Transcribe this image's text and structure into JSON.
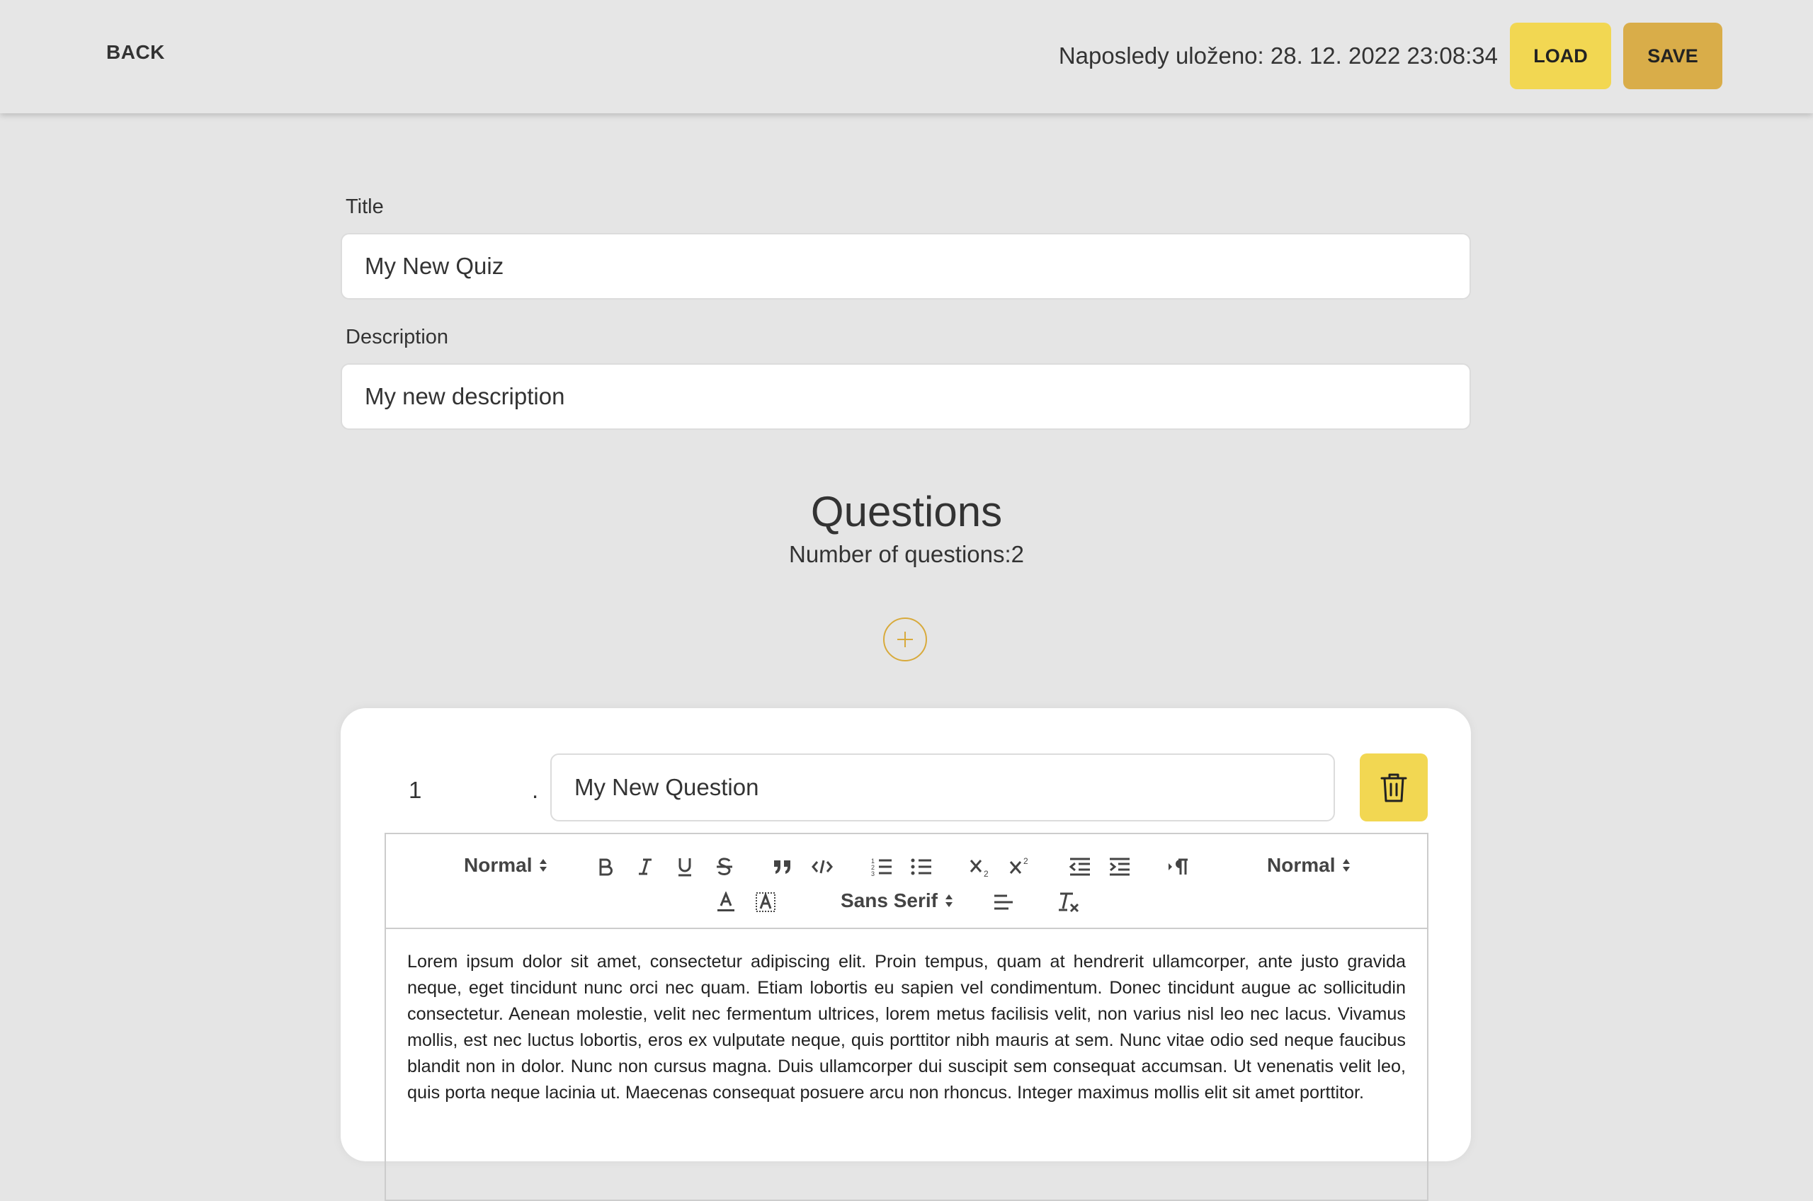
{
  "header": {
    "back_label": "BACK",
    "last_saved": "Naposledy uloženo: 28. 12. 2022 23:08:34",
    "load_label": "LOAD",
    "save_label": "SAVE"
  },
  "form": {
    "title_label": "Title",
    "title_value": "My New Quiz",
    "description_label": "Description",
    "description_value": "My new description"
  },
  "questions": {
    "heading": "Questions",
    "count_text": "Number of questions:2",
    "add_icon": "plus-circle-icon"
  },
  "question_items": [
    {
      "number": "1",
      "separator": ".",
      "text": "My New Question",
      "delete_icon": "trash-icon",
      "editor": {
        "toolbar": {
          "header_select": "Normal",
          "size_select": "Normal",
          "font_select": "Sans Serif",
          "buttons": [
            "bold",
            "italic",
            "underline",
            "strike",
            "blockquote",
            "code-block",
            "ordered-list",
            "bullet-list",
            "subscript",
            "superscript",
            "outdent",
            "indent",
            "direction",
            "color",
            "background",
            "align",
            "clean"
          ]
        },
        "content": "Lorem ipsum dolor sit amet, consectetur adipiscing elit. Proin tempus, quam at hendrerit ullamcorper, ante justo gravida neque, eget tincidunt nunc orci nec quam. Etiam lobortis eu sapien vel condimentum. Donec tincidunt augue ac sollicitudin consectetur. Aenean molestie, velit nec fermentum ultrices, lorem metus facilisis velit, non varius nisl leo nec lacus. Vivamus mollis, est nec luctus lobortis, eros ex vulputate neque, quis porttitor nibh mauris at sem. Nunc vitae odio sed neque faucibus blandit non in dolor. Nunc non cursus magna. Duis ullamcorper dui suscipit sem consequat accumsan. Ut venenatis velit leo, quis porta neque lacinia ut. Maecenas consequat posuere arcu non rhoncus. Integer maximus mollis elit sit amet porttitor."
      }
    }
  ],
  "colors": {
    "background": "#e5e5e5",
    "load_button": "#f2d752",
    "save_button": "#d9ad49",
    "accent": "#d8aa3c"
  }
}
